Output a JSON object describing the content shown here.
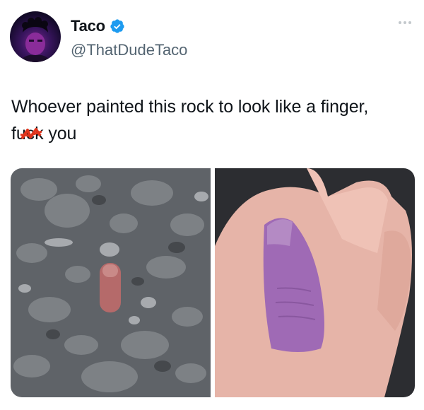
{
  "tweet": {
    "display_name": "Taco",
    "handle": "@ThatDudeTaco",
    "verified": true,
    "text_line1": "Whoever painted this rock to look like a finger,",
    "text_line2_pre": "f",
    "text_line2_censored": "u",
    "text_line2_post": "ck you"
  },
  "icons": {
    "verified": "verified-badge-icon",
    "more": "more-options-icon"
  },
  "colors": {
    "verified_blue": "#1d9bf0",
    "censor_red": "#e0341c",
    "handle_gray": "#536471"
  },
  "media": [
    {
      "description_name": "rock-on-pebbles-photo"
    },
    {
      "description_name": "rock-in-hand-photo"
    }
  ]
}
